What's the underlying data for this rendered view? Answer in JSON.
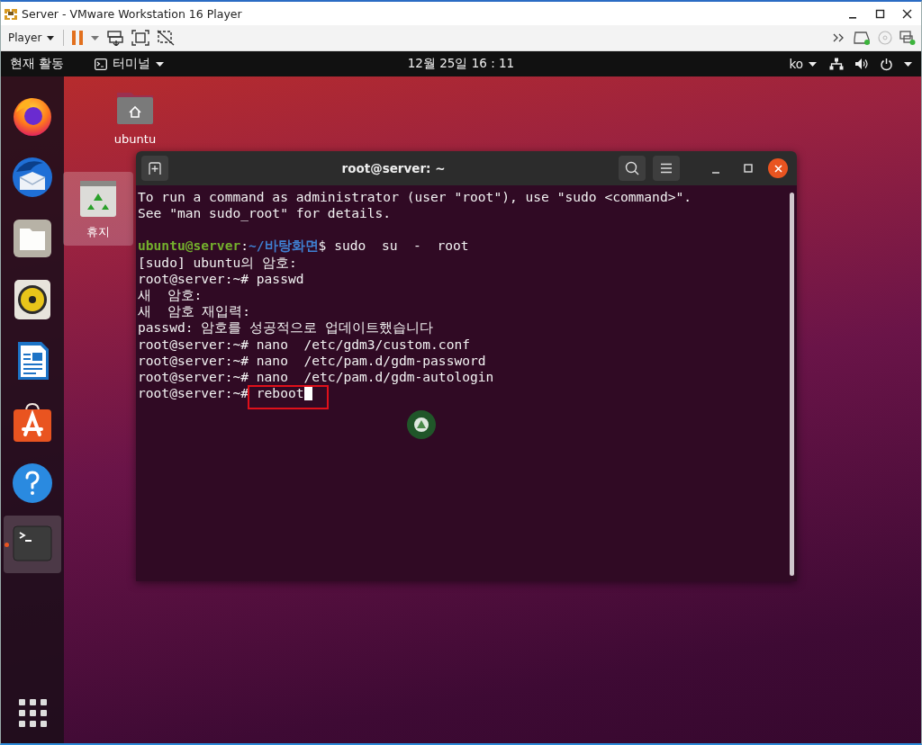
{
  "window": {
    "title": "Server - VMware Workstation 16 Player"
  },
  "toolbar": {
    "menu": "Player"
  },
  "top_bar": {
    "activities": "현재 활동",
    "app_menu": "터미널",
    "clock": "12월 25일  16 : 11",
    "input_source": "ko"
  },
  "dock": {
    "items": [
      {
        "kind": "firefox",
        "running": false
      },
      {
        "kind": "thunderbird",
        "running": false
      },
      {
        "kind": "files",
        "running": false
      },
      {
        "kind": "rhythmbox",
        "running": false
      },
      {
        "kind": "writer",
        "running": false
      },
      {
        "kind": "software",
        "running": false
      },
      {
        "kind": "help",
        "running": false
      },
      {
        "kind": "terminal",
        "running": true
      }
    ]
  },
  "desktop_icons": [
    {
      "label": "ubuntu",
      "kind": "home",
      "selected": false
    },
    {
      "label": "휴지",
      "kind": "trash",
      "selected": true
    }
  ],
  "terminal": {
    "title": "root@server: ~",
    "cursor_visible": true,
    "blocks": [
      [
        [
          {
            "text": "To run a command as administrator (user \"root\"), use \"sudo <command>\".",
            "kind": "plain"
          }
        ],
        [
          {
            "text": "See \"man sudo_root\" for details.",
            "kind": "plain"
          }
        ]
      ],
      [
        [
          {
            "text": "ubuntu@server",
            "kind": "user"
          },
          {
            "text": ":",
            "kind": "plain"
          },
          {
            "text": "~/바탕화면",
            "kind": "path"
          },
          {
            "text": "$ sudo  su  -  root",
            "kind": "plain"
          }
        ],
        [
          {
            "text": "[sudo] ubuntu의 암호:",
            "kind": "plain"
          }
        ],
        [
          {
            "text": "root@server:~# passwd",
            "kind": "plain"
          }
        ],
        [
          {
            "text": "새  암호:",
            "kind": "plain"
          }
        ],
        [
          {
            "text": "새  암호 재입력:",
            "kind": "plain"
          }
        ],
        [
          {
            "text": "passwd: 암호를 성공적으로 업데이트했습니다",
            "kind": "plain"
          }
        ],
        [
          {
            "text": "root@server:~# nano  /etc/gdm3/custom.conf",
            "kind": "plain"
          }
        ],
        [
          {
            "text": "root@server:~# nano  /etc/pam.d/gdm-password",
            "kind": "plain"
          }
        ],
        [
          {
            "text": "root@server:~# nano  /etc/pam.d/gdm-autologin",
            "kind": "plain"
          }
        ],
        [
          {
            "text": "root@server:~# ",
            "kind": "plain"
          },
          {
            "text": "reboot",
            "kind": "marked"
          }
        ]
      ]
    ]
  }
}
